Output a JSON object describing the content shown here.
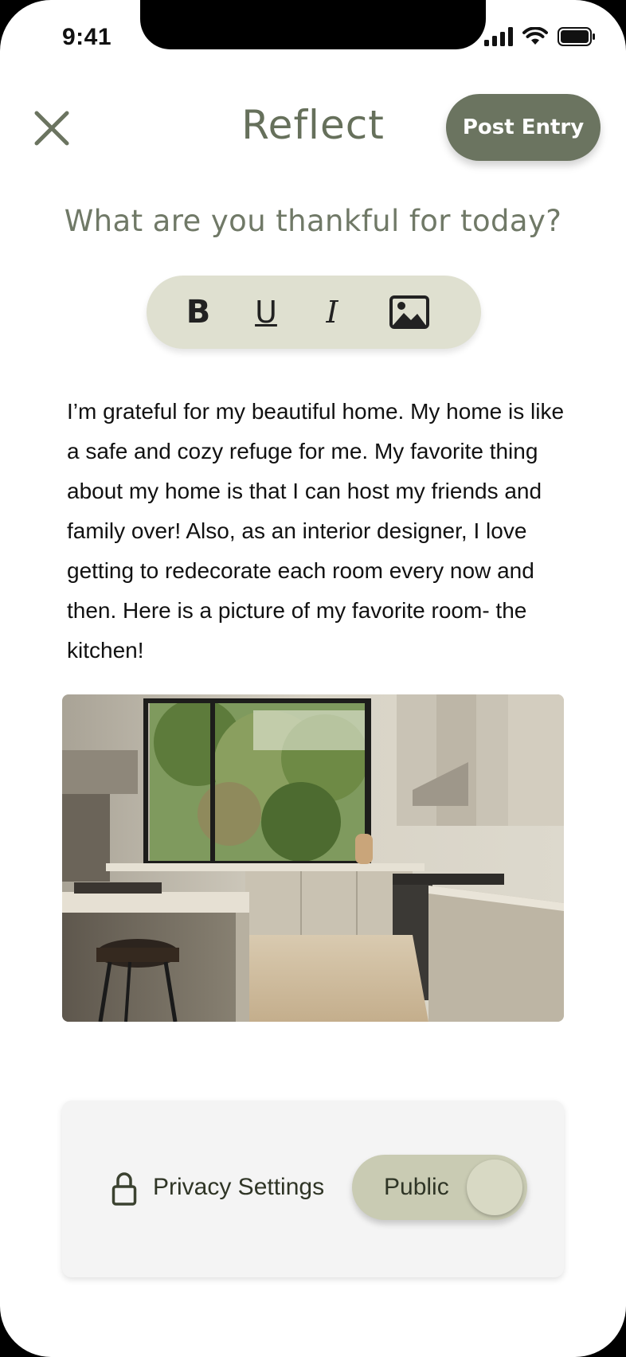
{
  "status_bar": {
    "time": "9:41"
  },
  "header": {
    "title": "Reflect",
    "post_label": "Post Entry"
  },
  "prompt": "What are you thankful for today?",
  "toolbar": {
    "bold": "B",
    "underline": "U",
    "italic": "I"
  },
  "entry": {
    "text": "I’m grateful for my beautiful home. My home is like a safe and cozy refuge for me. My favorite thing about my home is that I can host my friends and family over! Also, as an interior designer, I love getting to redecorate each room every now and then. Here is a picture of my favorite room- the kitchen!"
  },
  "privacy": {
    "label": "Privacy Settings",
    "toggle_label": "Public"
  },
  "colors": {
    "accent": "#6b7460",
    "title": "#66705b",
    "toolbar_bg": "#dfe0d0",
    "toggle_bg": "#c9cbb3"
  },
  "icons": [
    "close-icon",
    "signal-icon",
    "wifi-icon",
    "battery-icon",
    "image-icon",
    "lock-icon"
  ]
}
